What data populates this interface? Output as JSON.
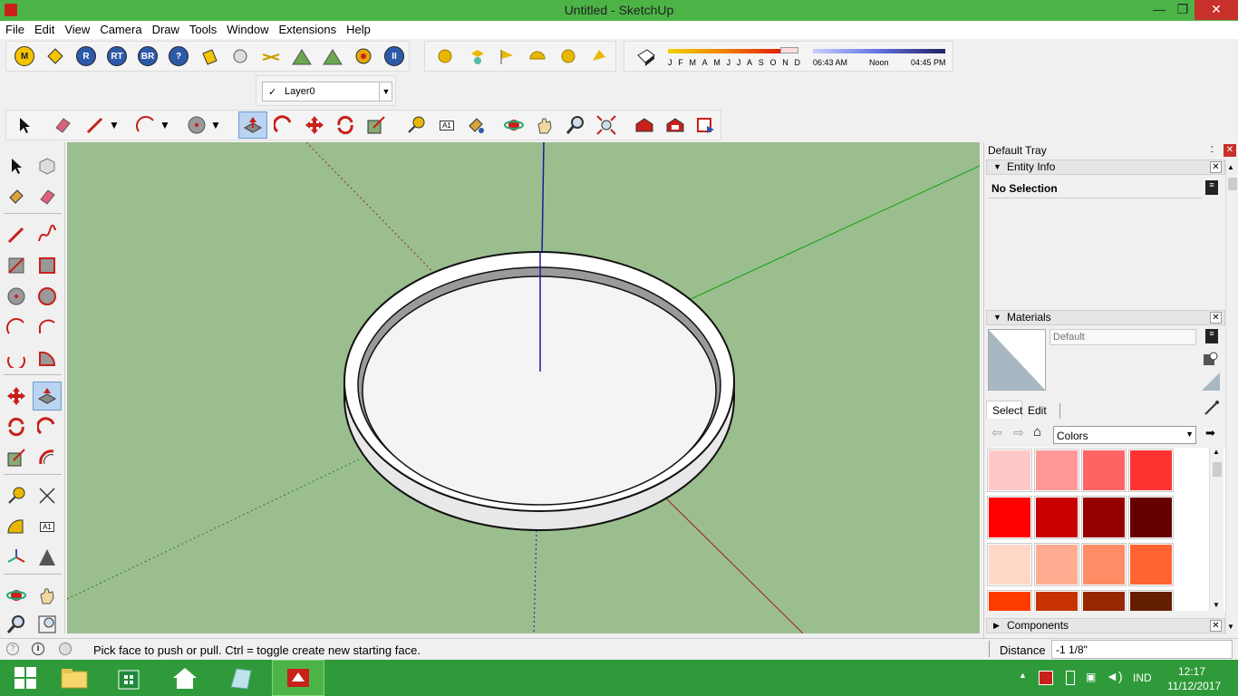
{
  "window": {
    "title": "Untitled - SketchUp",
    "minimize": "—",
    "restore": "❐",
    "close": "✕"
  },
  "menu": [
    "File",
    "Edit",
    "View",
    "Camera",
    "Draw",
    "Tools",
    "Window",
    "Extensions",
    "Help"
  ],
  "toolbar_top": {
    "circle_labels": [
      "M",
      "R",
      "RT",
      "BR",
      "?"
    ]
  },
  "shadows": {
    "months": [
      "J",
      "F",
      "M",
      "A",
      "M",
      "J",
      "J",
      "A",
      "S",
      "O",
      "N",
      "D"
    ],
    "time_start": "06:43 AM",
    "time_mid": "Noon",
    "time_end": "04:45 PM"
  },
  "layer": {
    "check": "✓",
    "name": "Layer0",
    "dropdown": "▼"
  },
  "text_tool_label": "A1",
  "tray": {
    "title": "Default Tray",
    "pin": "⍘",
    "close": "✕",
    "entity_info": {
      "title": "Entity Info",
      "selection": "No Selection"
    },
    "materials": {
      "title": "Materials",
      "name_placeholder": "Default",
      "tabs": [
        "Select",
        "Edit"
      ],
      "library": "Colors",
      "swatches": [
        "#ffc8c8",
        "#ff9898",
        "#ff6464",
        "#ff3232",
        "#ff0000",
        "#c80000",
        "#960000",
        "#640000",
        "#ffd8c8",
        "#ffac90",
        "#ff8c64",
        "#ff6432",
        "#ff3c00",
        "#c83200",
        "#962800",
        "#641e00"
      ]
    },
    "components": {
      "title": "Components"
    }
  },
  "status": {
    "hint": "Pick face to push or pull.  Ctrl = toggle create new starting face.",
    "measurement_label": "Distance",
    "measurement_value": "-1 1/8\""
  },
  "taskbar": {
    "lang": "IND",
    "time": "12:17",
    "date": "11/12/2017"
  },
  "colors": {
    "titlebar": "#4cb447",
    "viewport": "#9bbe8f",
    "taskbar": "#2f9a3a",
    "accent_red": "#c8201a"
  }
}
